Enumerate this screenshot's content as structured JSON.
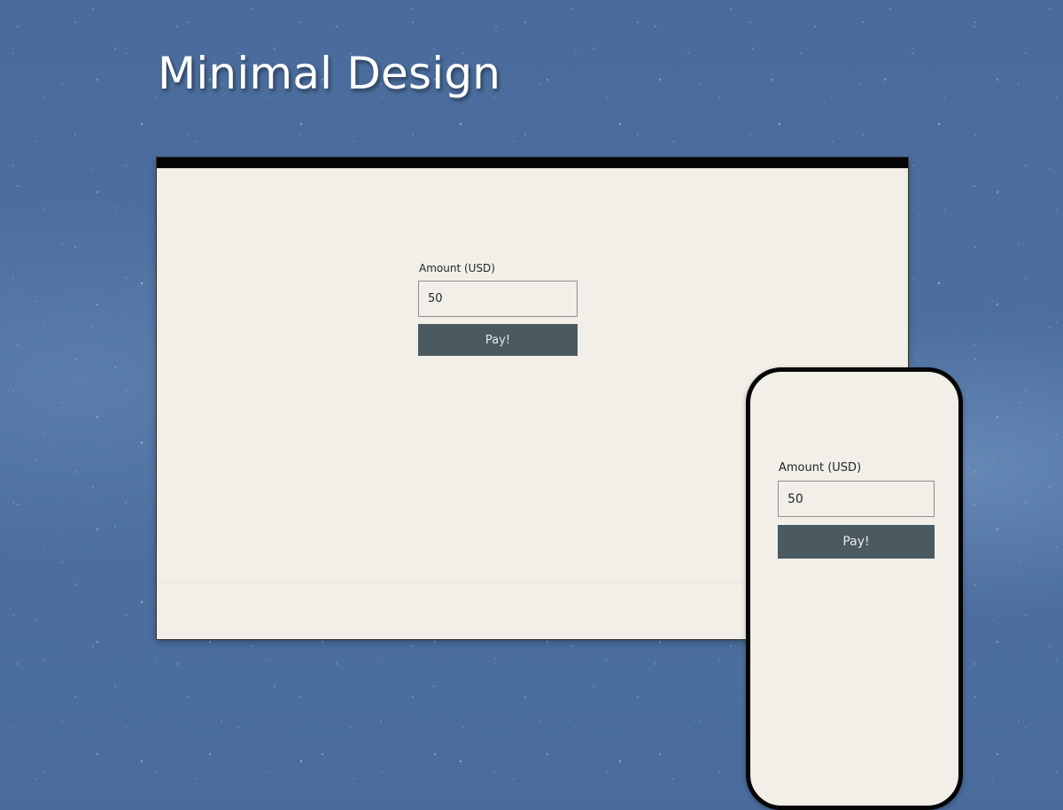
{
  "headline": "Minimal Design",
  "desktop": {
    "form": {
      "amount_label": "Amount (USD)",
      "amount_value": "50",
      "pay_label": "Pay!"
    }
  },
  "mobile": {
    "form": {
      "amount_label": "Amount (USD)",
      "amount_value": "50",
      "pay_label": "Pay!"
    }
  },
  "colors": {
    "background": "#4a6c9c",
    "surface": "#f1efe8",
    "button": "#4b5a61",
    "frame": "#050505"
  }
}
